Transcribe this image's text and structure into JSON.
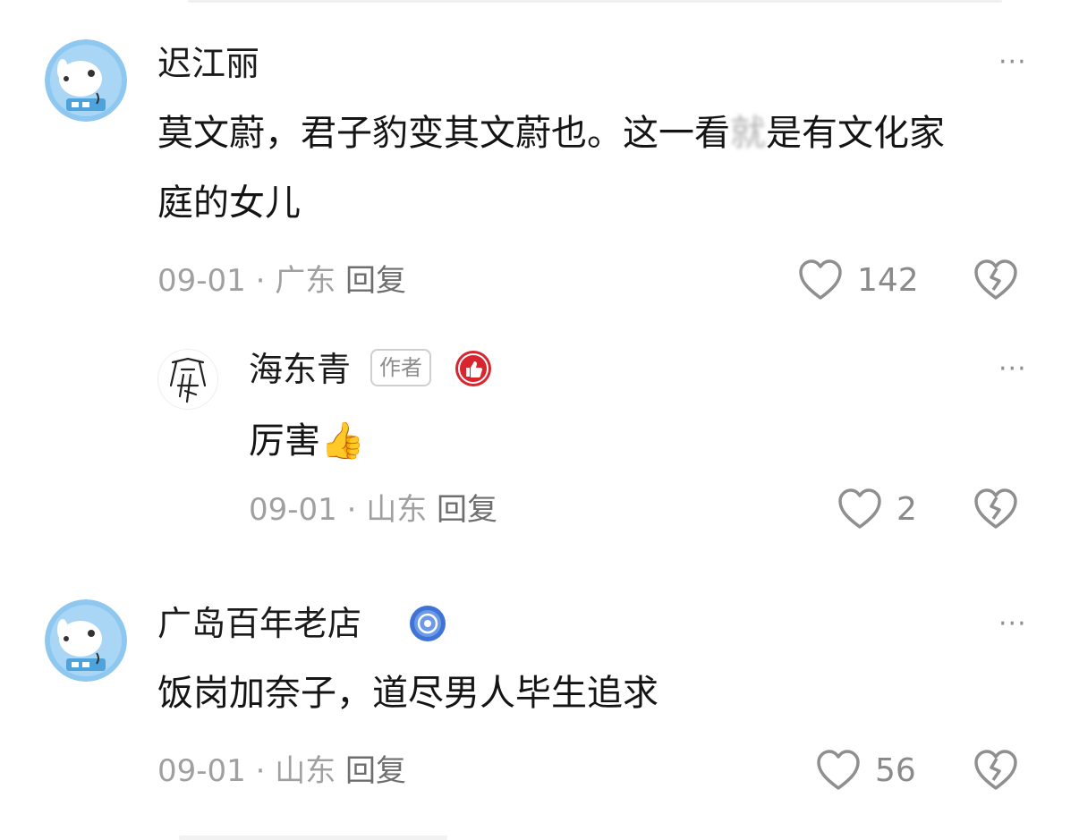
{
  "comments": [
    {
      "username": "迟江丽",
      "text_part1": "莫文蔚，君子豹变其文蔚也。这一看",
      "text_blur": "就",
      "text_part2": "是有文化家",
      "text_line2": "庭的女儿",
      "date": "09-01",
      "separator": "·",
      "location": "广东",
      "reply_label": "回复",
      "likes": "142"
    },
    {
      "username": "海东青",
      "badge": "作者",
      "text": "厉害👍",
      "date": "09-01",
      "separator": "·",
      "location": "山东",
      "reply_label": "回复",
      "likes": "2"
    },
    {
      "username": "广岛百年老店",
      "text": "饭岗加奈子，道尽男人毕生追求",
      "date": "09-01",
      "separator": "·",
      "location": "山东",
      "reply_label": "回复",
      "likes": "56"
    }
  ],
  "more_label": "···",
  "colors": {
    "accent_red": "#d8252e",
    "badge_blue": "#3f73d6",
    "meta_gray": "#a0a0a0",
    "icon_gray": "#8f8f8f"
  },
  "icons": [
    "heart-icon",
    "broken-heart-icon",
    "more-icon",
    "thumbs-up-badge-icon",
    "verified-badge-icon"
  ]
}
